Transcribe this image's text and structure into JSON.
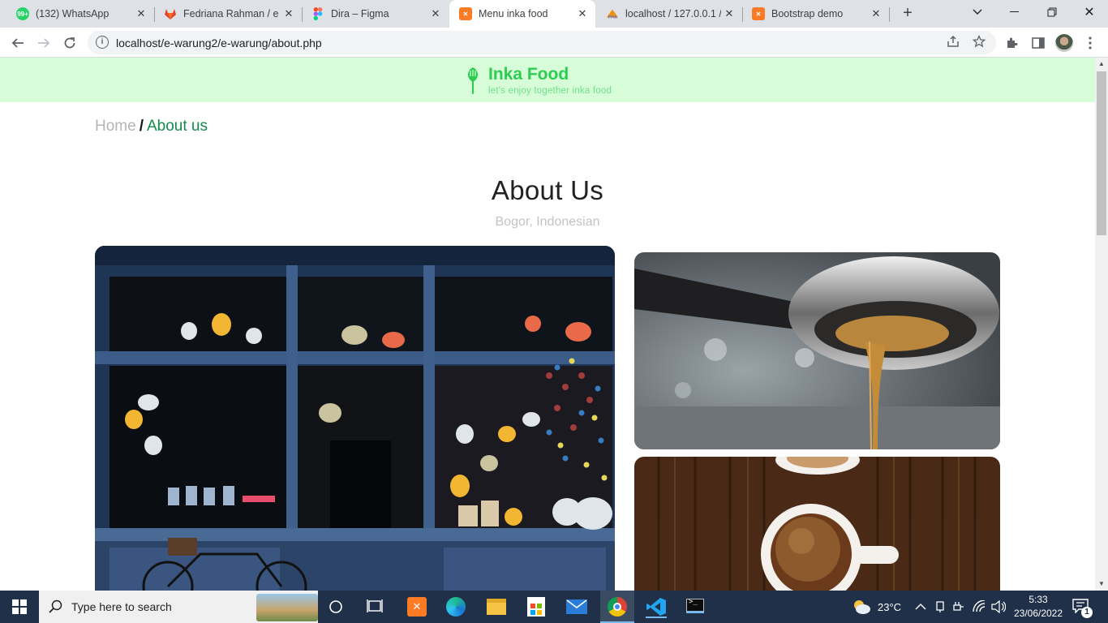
{
  "browser": {
    "tabs": [
      {
        "label": "(132) WhatsApp",
        "favicon": "whatsapp-icon",
        "badge": "99+",
        "active": false
      },
      {
        "label": "Fedriana Rahman / e-w",
        "favicon": "gitlab-icon",
        "active": false
      },
      {
        "label": "Dira – Figma",
        "favicon": "figma-icon",
        "active": false
      },
      {
        "label": "Menu inka food",
        "favicon": "xampp-icon",
        "active": true
      },
      {
        "label": "localhost / 127.0.0.1 /",
        "favicon": "phpmyadmin-icon",
        "active": false
      },
      {
        "label": "Bootstrap demo",
        "favicon": "xampp-icon",
        "active": false
      }
    ],
    "url": "localhost/e-warung2/e-warung/about.php"
  },
  "site": {
    "brand_name": "Inka Food",
    "tagline": "let's enjoy together inka food",
    "breadcrumb": {
      "home": "Home",
      "separator": "/",
      "current": "About us"
    },
    "title": "About Us",
    "location": "Bogor, Indonesian"
  },
  "taskbar": {
    "search_placeholder": "Type here to search",
    "temperature": "23°C",
    "time": "5:33",
    "date": "23/06/2022",
    "notification_count": "1"
  },
  "colors": {
    "header_bg": "#d7fcd8",
    "brand_green": "#2ecc52",
    "breadcrumb_active": "#138a4c"
  }
}
